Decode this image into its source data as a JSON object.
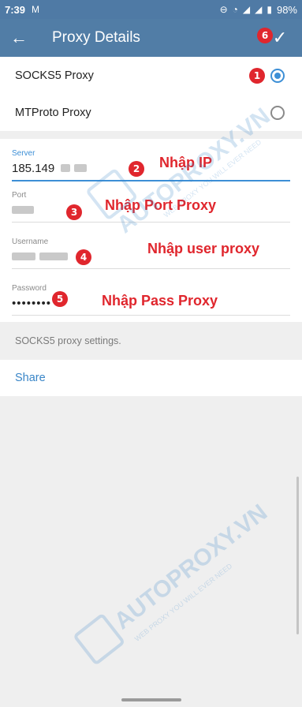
{
  "status_bar": {
    "time": "7:39",
    "mail_glyph": "M",
    "battery": "98%",
    "icons": [
      "minus-circle-icon",
      "wifi-icon",
      "signal-icon",
      "battery-icon"
    ]
  },
  "app_bar": {
    "title": "Proxy Details",
    "back_icon": "arrow-left-icon",
    "done_icon": "check-icon"
  },
  "proxy_types": [
    {
      "label": "SOCKS5 Proxy",
      "selected": true,
      "badge": "1"
    },
    {
      "label": "MTProto Proxy",
      "selected": false
    }
  ],
  "fields": {
    "server": {
      "label": "Server",
      "value": "185.149",
      "badge": "2",
      "annotation": "Nhập IP"
    },
    "port": {
      "label": "Port",
      "value": "",
      "badge": "3",
      "annotation": "Nhập Port Proxy"
    },
    "username": {
      "label": "Username",
      "value": "",
      "badge": "4",
      "annotation": "Nhập user proxy"
    },
    "password": {
      "label": "Password",
      "value": "••••••••",
      "badge": "5",
      "annotation": "Nhập Pass Proxy"
    }
  },
  "done_badge": "6",
  "hint": "SOCKS5 proxy settings.",
  "share_label": "Share",
  "watermark": {
    "brand": "AUTOPROXY.VN",
    "tagline": "WEB PROXY YOU WILL EVER NEED"
  },
  "colors": {
    "app_bar": "#517da6",
    "accent": "#3d8fd6",
    "annotation_red": "#e0262d",
    "background": "#efefef"
  }
}
